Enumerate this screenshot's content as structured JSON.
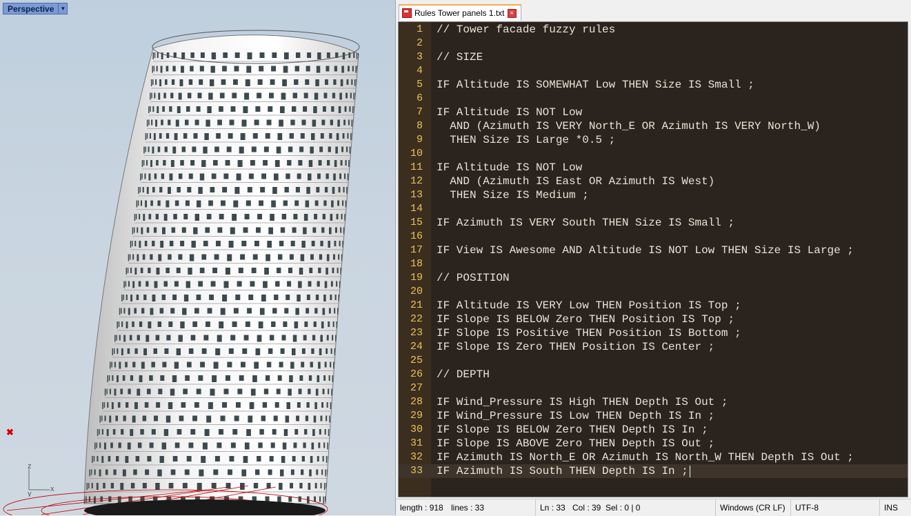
{
  "viewport": {
    "name": "Perspective",
    "menu_icon": "dropdown-triangle-icon",
    "axes": {
      "z": "z",
      "x": "x",
      "y": "y"
    }
  },
  "tab": {
    "title": "Rules Tower panels 1.txt",
    "close_label": "×"
  },
  "code_lines": [
    "// Tower facade fuzzy rules",
    "",
    "// SIZE",
    "",
    "IF Altitude IS SOMEWHAT Low THEN Size IS Small ;",
    "",
    "IF Altitude IS NOT Low",
    "  AND (Azimuth IS VERY North_E OR Azimuth IS VERY North_W)",
    "  THEN Size IS Large *0.5 ;",
    "",
    "IF Altitude IS NOT Low",
    "  AND (Azimuth IS East OR Azimuth IS West)",
    "  THEN Size IS Medium ;",
    "",
    "IF Azimuth IS VERY South THEN Size IS Small ;",
    "",
    "IF View IS Awesome AND Altitude IS NOT Low THEN Size IS Large ;",
    "",
    "// POSITION",
    "",
    "IF Altitude IS VERY Low THEN Position IS Top ;",
    "IF Slope IS BELOW Zero THEN Position IS Top ;",
    "IF Slope IS Positive THEN Position IS Bottom ;",
    "IF Slope IS Zero THEN Position IS Center ;",
    "",
    "// DEPTH",
    "",
    "IF Wind_Pressure IS High THEN Depth IS Out ;",
    "IF Wind_Pressure IS Low THEN Depth IS In ;",
    "IF Slope IS BELOW Zero THEN Depth IS In ;",
    "IF Slope IS ABOVE Zero THEN Depth IS Out ;",
    "IF Azimuth IS North_E OR Azimuth IS North_W THEN Depth IS Out ;",
    "IF Azimuth IS South THEN Depth IS In ;"
  ],
  "current_line": 33,
  "status": {
    "length": "length : 918",
    "lines": "lines : 33",
    "ln": "Ln : 33",
    "col": "Col : 39",
    "sel": "Sel : 0 | 0",
    "eol": "Windows (CR LF)",
    "encoding": "UTF-8",
    "mode": "INS"
  },
  "colors": {
    "editor_bg": "#2b231d",
    "gutter_bg": "#3b2e1f",
    "line_number": "#e9c45a",
    "code_text": "#e9e4d8",
    "viewport_label": "#7b9ad6",
    "tab_accent": "#f6a94a"
  }
}
